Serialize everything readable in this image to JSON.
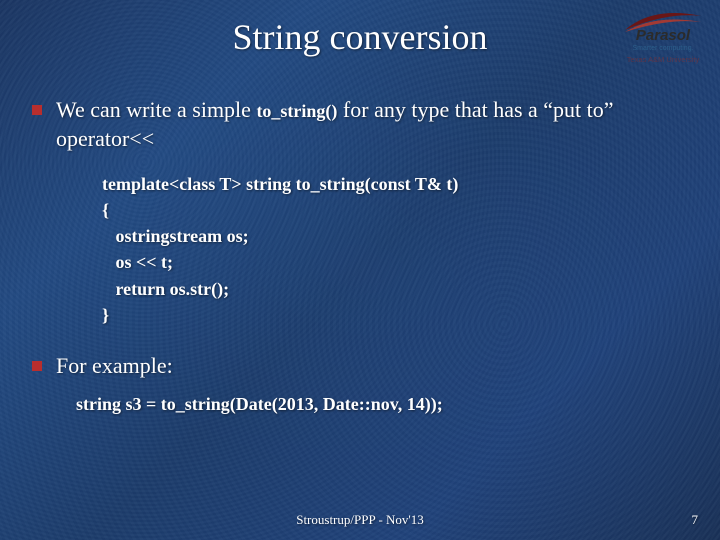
{
  "title": "String conversion",
  "logo": {
    "name": "Parasol",
    "tagline": "Smarter computing.",
    "subline": "Texas A&M University"
  },
  "bullets": [
    {
      "pre": "We can write a simple ",
      "code": "to_string()",
      "post": " for any type that has a “put to” operator<<"
    },
    {
      "pre": "For example:",
      "code": "",
      "post": ""
    }
  ],
  "code1": "template<class T> string to_string(const T& t)\n{\n   ostringstream os;\n   os << t;\n   return os.str();\n}",
  "code2": "string s3 = to_string(Date(2013, Date::nov, 14));",
  "footer": "Stroustrup/PPP - Nov'13",
  "page": "7"
}
